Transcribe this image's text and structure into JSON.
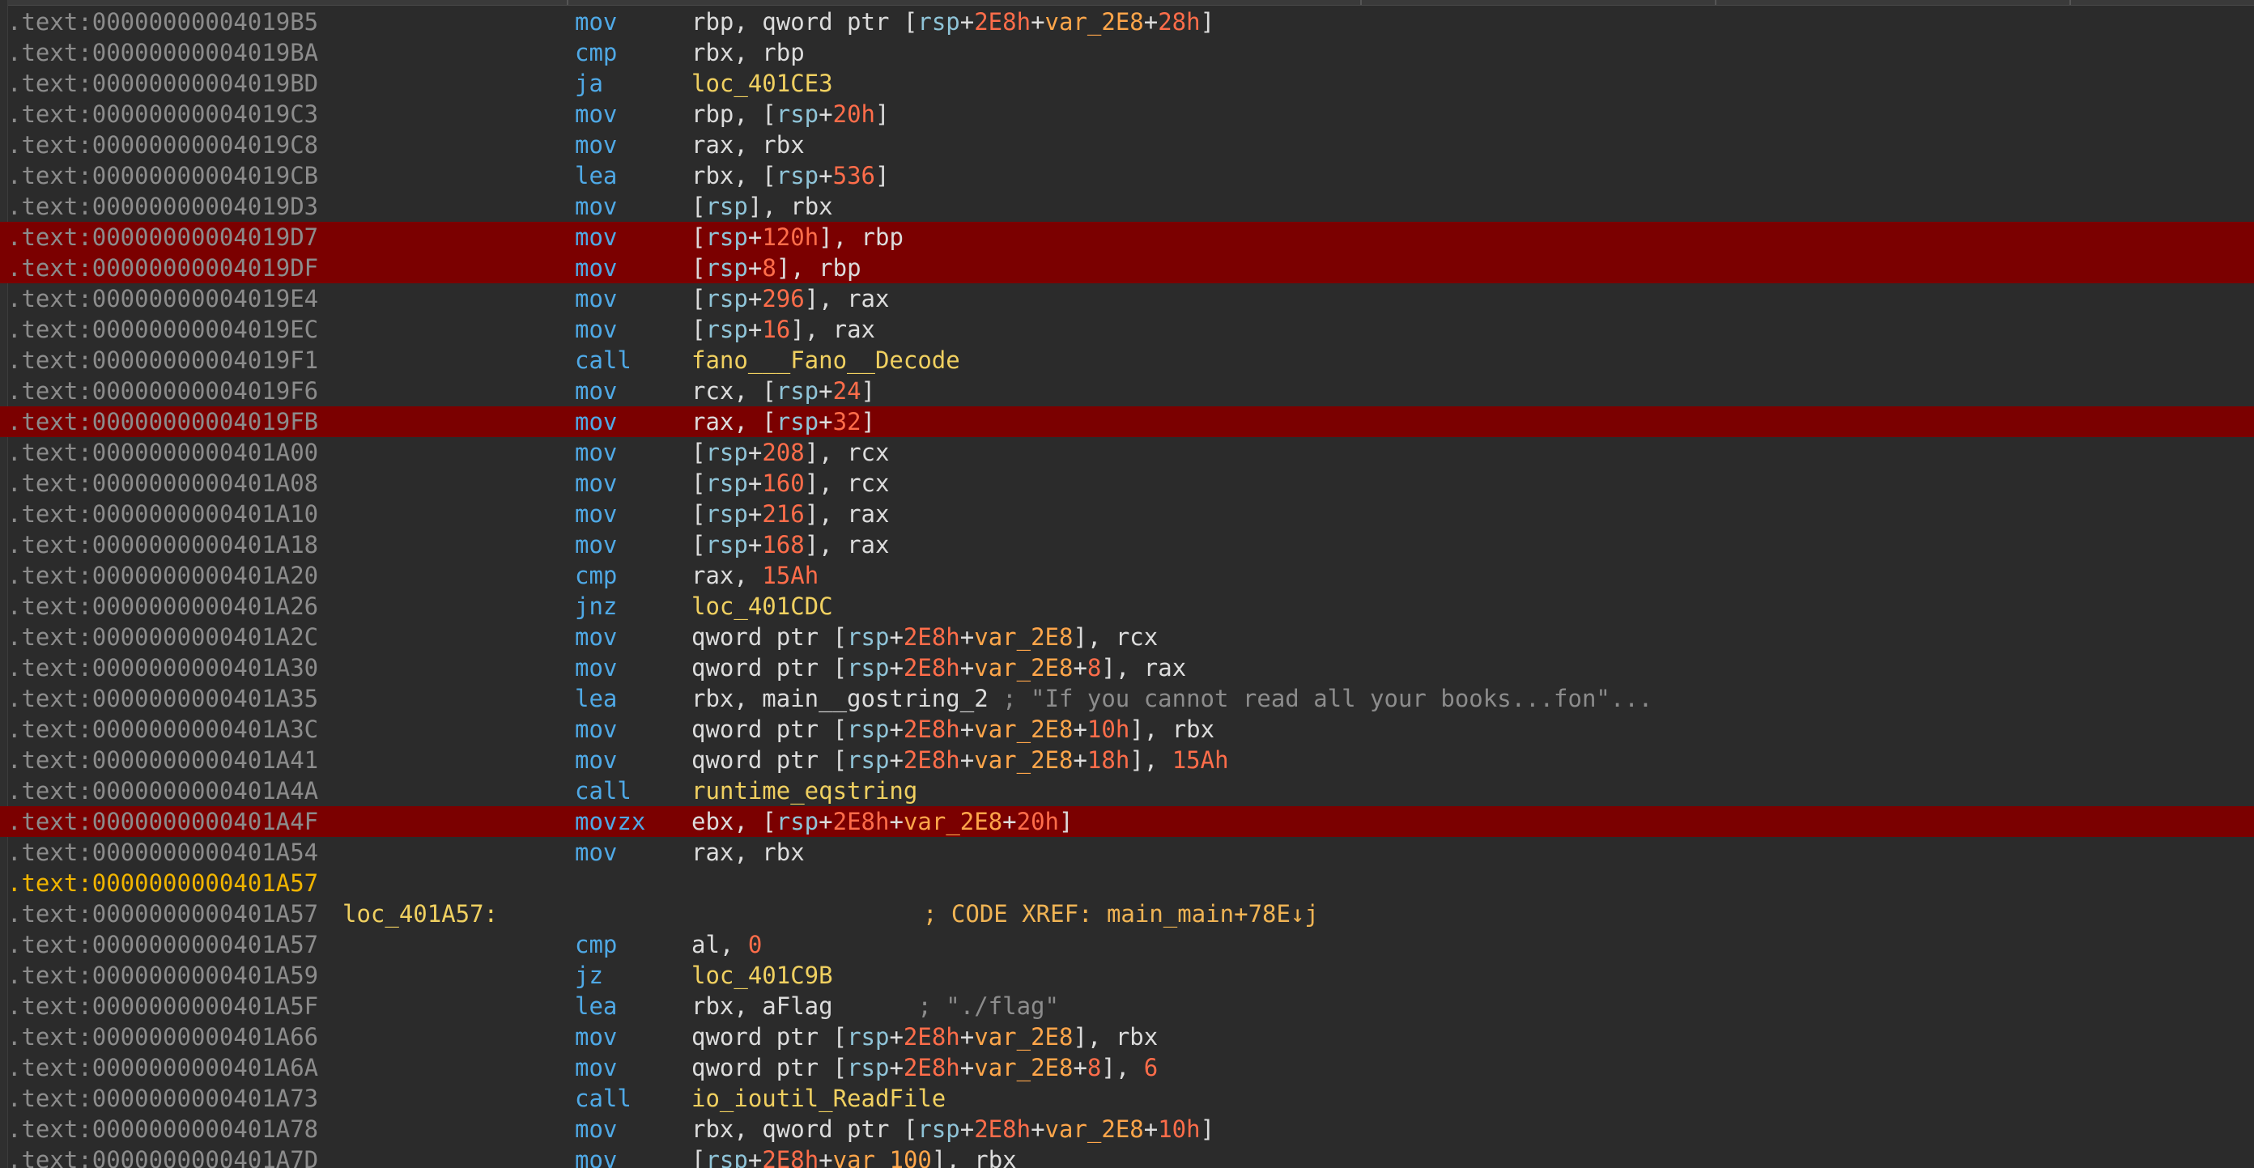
{
  "listing": {
    "rows": [
      {
        "addr": ".text:00000000004019B5",
        "mnem": "mov",
        "ops": [
          [
            "t",
            "rbp, qword ptr ["
          ],
          [
            "r",
            "rsp"
          ],
          [
            "t",
            "+"
          ],
          [
            "n",
            "2E8h"
          ],
          [
            "t",
            "+"
          ],
          [
            "v",
            "var_2E8"
          ],
          [
            "t",
            "+"
          ],
          [
            "n",
            "28h"
          ],
          [
            "t",
            "]"
          ]
        ]
      },
      {
        "addr": ".text:00000000004019BA",
        "mnem": "cmp",
        "ops": [
          [
            "t",
            "rbx, rbp"
          ]
        ]
      },
      {
        "addr": ".text:00000000004019BD",
        "mnem": "ja",
        "ops": [
          [
            "s",
            "loc_401CE3"
          ]
        ]
      },
      {
        "addr": ".text:00000000004019C3",
        "mnem": "mov",
        "ops": [
          [
            "t",
            "rbp, ["
          ],
          [
            "r",
            "rsp"
          ],
          [
            "t",
            "+"
          ],
          [
            "n",
            "20h"
          ],
          [
            "t",
            "]"
          ]
        ]
      },
      {
        "addr": ".text:00000000004019C8",
        "mnem": "mov",
        "ops": [
          [
            "t",
            "rax, rbx"
          ]
        ]
      },
      {
        "addr": ".text:00000000004019CB",
        "mnem": "lea",
        "ops": [
          [
            "t",
            "rbx, ["
          ],
          [
            "r",
            "rsp"
          ],
          [
            "t",
            "+"
          ],
          [
            "n",
            "536"
          ],
          [
            "t",
            "]"
          ]
        ]
      },
      {
        "addr": ".text:00000000004019D3",
        "mnem": "mov",
        "ops": [
          [
            "t",
            "["
          ],
          [
            "r",
            "rsp"
          ],
          [
            "t",
            "], rbx"
          ]
        ]
      },
      {
        "addr": ".text:00000000004019D7",
        "mnem": "mov",
        "hl": true,
        "ops": [
          [
            "t",
            "["
          ],
          [
            "r",
            "rsp"
          ],
          [
            "t",
            "+"
          ],
          [
            "n",
            "120h"
          ],
          [
            "t",
            "], rbp"
          ]
        ]
      },
      {
        "addr": ".text:00000000004019DF",
        "mnem": "mov",
        "hl": true,
        "ops": [
          [
            "t",
            "["
          ],
          [
            "r",
            "rsp"
          ],
          [
            "t",
            "+"
          ],
          [
            "n",
            "8"
          ],
          [
            "t",
            "], rbp"
          ]
        ]
      },
      {
        "addr": ".text:00000000004019E4",
        "mnem": "mov",
        "ops": [
          [
            "t",
            "["
          ],
          [
            "r",
            "rsp"
          ],
          [
            "t",
            "+"
          ],
          [
            "n",
            "296"
          ],
          [
            "t",
            "], rax"
          ]
        ]
      },
      {
        "addr": ".text:00000000004019EC",
        "mnem": "mov",
        "ops": [
          [
            "t",
            "["
          ],
          [
            "r",
            "rsp"
          ],
          [
            "t",
            "+"
          ],
          [
            "n",
            "16"
          ],
          [
            "t",
            "], rax"
          ]
        ]
      },
      {
        "addr": ".text:00000000004019F1",
        "mnem": "call",
        "ops": [
          [
            "s",
            "fano___Fano__Decode"
          ]
        ]
      },
      {
        "addr": ".text:00000000004019F6",
        "mnem": "mov",
        "ops": [
          [
            "t",
            "rcx, ["
          ],
          [
            "r",
            "rsp"
          ],
          [
            "t",
            "+"
          ],
          [
            "n",
            "24"
          ],
          [
            "t",
            "]"
          ]
        ]
      },
      {
        "addr": ".text:00000000004019FB",
        "mnem": "mov",
        "hl": true,
        "ops": [
          [
            "t",
            "rax, ["
          ],
          [
            "r",
            "rsp"
          ],
          [
            "t",
            "+"
          ],
          [
            "n",
            "32"
          ],
          [
            "t",
            "]"
          ]
        ]
      },
      {
        "addr": ".text:0000000000401A00",
        "mnem": "mov",
        "ops": [
          [
            "t",
            "["
          ],
          [
            "r",
            "rsp"
          ],
          [
            "t",
            "+"
          ],
          [
            "n",
            "208"
          ],
          [
            "t",
            "], rcx"
          ]
        ]
      },
      {
        "addr": ".text:0000000000401A08",
        "mnem": "mov",
        "ops": [
          [
            "t",
            "["
          ],
          [
            "r",
            "rsp"
          ],
          [
            "t",
            "+"
          ],
          [
            "n",
            "160"
          ],
          [
            "t",
            "], rcx"
          ]
        ]
      },
      {
        "addr": ".text:0000000000401A10",
        "mnem": "mov",
        "ops": [
          [
            "t",
            "["
          ],
          [
            "r",
            "rsp"
          ],
          [
            "t",
            "+"
          ],
          [
            "n",
            "216"
          ],
          [
            "t",
            "], rax"
          ]
        ]
      },
      {
        "addr": ".text:0000000000401A18",
        "mnem": "mov",
        "ops": [
          [
            "t",
            "["
          ],
          [
            "r",
            "rsp"
          ],
          [
            "t",
            "+"
          ],
          [
            "n",
            "168"
          ],
          [
            "t",
            "], rax"
          ]
        ]
      },
      {
        "addr": ".text:0000000000401A20",
        "mnem": "cmp",
        "ops": [
          [
            "t",
            "rax, "
          ],
          [
            "n",
            "15Ah"
          ]
        ]
      },
      {
        "addr": ".text:0000000000401A26",
        "mnem": "jnz",
        "ops": [
          [
            "s",
            "loc_401CDC"
          ]
        ]
      },
      {
        "addr": ".text:0000000000401A2C",
        "mnem": "mov",
        "ops": [
          [
            "t",
            "qword ptr ["
          ],
          [
            "r",
            "rsp"
          ],
          [
            "t",
            "+"
          ],
          [
            "n",
            "2E8h"
          ],
          [
            "t",
            "+"
          ],
          [
            "v",
            "var_2E8"
          ],
          [
            "t",
            "], rcx"
          ]
        ]
      },
      {
        "addr": ".text:0000000000401A30",
        "mnem": "mov",
        "ops": [
          [
            "t",
            "qword ptr ["
          ],
          [
            "r",
            "rsp"
          ],
          [
            "t",
            "+"
          ],
          [
            "n",
            "2E8h"
          ],
          [
            "t",
            "+"
          ],
          [
            "v",
            "var_2E8"
          ],
          [
            "t",
            "+"
          ],
          [
            "n",
            "8"
          ],
          [
            "t",
            "], rax"
          ]
        ]
      },
      {
        "addr": ".text:0000000000401A35",
        "mnem": "lea",
        "ops": [
          [
            "t",
            "rbx, main__gostring_2 "
          ],
          [
            "c",
            "; \"If you cannot read all your books...fon\"..."
          ]
        ]
      },
      {
        "addr": ".text:0000000000401A3C",
        "mnem": "mov",
        "ops": [
          [
            "t",
            "qword ptr ["
          ],
          [
            "r",
            "rsp"
          ],
          [
            "t",
            "+"
          ],
          [
            "n",
            "2E8h"
          ],
          [
            "t",
            "+"
          ],
          [
            "v",
            "var_2E8"
          ],
          [
            "t",
            "+"
          ],
          [
            "n",
            "10h"
          ],
          [
            "t",
            "], rbx"
          ]
        ]
      },
      {
        "addr": ".text:0000000000401A41",
        "mnem": "mov",
        "ops": [
          [
            "t",
            "qword ptr ["
          ],
          [
            "r",
            "rsp"
          ],
          [
            "t",
            "+"
          ],
          [
            "n",
            "2E8h"
          ],
          [
            "t",
            "+"
          ],
          [
            "v",
            "var_2E8"
          ],
          [
            "t",
            "+"
          ],
          [
            "n",
            "18h"
          ],
          [
            "t",
            "], "
          ],
          [
            "n",
            "15Ah"
          ]
        ]
      },
      {
        "addr": ".text:0000000000401A4A",
        "mnem": "call",
        "ops": [
          [
            "s",
            "runtime_eqstring"
          ]
        ]
      },
      {
        "addr": ".text:0000000000401A4F",
        "mnem": "movzx",
        "hl": true,
        "ops": [
          [
            "t",
            "ebx, ["
          ],
          [
            "r",
            "rsp"
          ],
          [
            "t",
            "+"
          ],
          [
            "n",
            "2E8h"
          ],
          [
            "t",
            "+"
          ],
          [
            "v",
            "var_2E8"
          ],
          [
            "t",
            "+"
          ],
          [
            "n",
            "20h"
          ],
          [
            "t",
            "]"
          ]
        ]
      },
      {
        "addr": ".text:0000000000401A54",
        "mnem": "mov",
        "ops": [
          [
            "t",
            "rax, rbx"
          ]
        ]
      },
      {
        "addr": ".text:0000000000401A57",
        "addr_gold": true,
        "mnem": "",
        "ops": []
      },
      {
        "addr": ".text:0000000000401A57",
        "label": "loc_401A57:",
        "mnem": "",
        "ops": [],
        "xref": "; CODE XREF: main_main+78E↓j"
      },
      {
        "addr": ".text:0000000000401A57",
        "mnem": "cmp",
        "ops": [
          [
            "t",
            "al, "
          ],
          [
            "n",
            "0"
          ]
        ]
      },
      {
        "addr": ".text:0000000000401A59",
        "mnem": "jz",
        "ops": [
          [
            "s",
            "loc_401C9B"
          ]
        ]
      },
      {
        "addr": ".text:0000000000401A5F",
        "mnem": "lea",
        "ops": [
          [
            "t",
            "rbx, aFlag      "
          ],
          [
            "c",
            "; \"./flag\""
          ]
        ]
      },
      {
        "addr": ".text:0000000000401A66",
        "mnem": "mov",
        "ops": [
          [
            "t",
            "qword ptr ["
          ],
          [
            "r",
            "rsp"
          ],
          [
            "t",
            "+"
          ],
          [
            "n",
            "2E8h"
          ],
          [
            "t",
            "+"
          ],
          [
            "v",
            "var_2E8"
          ],
          [
            "t",
            "], rbx"
          ]
        ]
      },
      {
        "addr": ".text:0000000000401A6A",
        "mnem": "mov",
        "ops": [
          [
            "t",
            "qword ptr ["
          ],
          [
            "r",
            "rsp"
          ],
          [
            "t",
            "+"
          ],
          [
            "n",
            "2E8h"
          ],
          [
            "t",
            "+"
          ],
          [
            "v",
            "var_2E8"
          ],
          [
            "t",
            "+"
          ],
          [
            "n",
            "8"
          ],
          [
            "t",
            "], "
          ],
          [
            "n",
            "6"
          ]
        ]
      },
      {
        "addr": ".text:0000000000401A73",
        "mnem": "call",
        "ops": [
          [
            "s",
            "io_ioutil_ReadFile"
          ]
        ]
      },
      {
        "addr": ".text:0000000000401A78",
        "mnem": "mov",
        "ops": [
          [
            "t",
            "rbx, qword ptr ["
          ],
          [
            "r",
            "rsp"
          ],
          [
            "t",
            "+"
          ],
          [
            "n",
            "2E8h"
          ],
          [
            "t",
            "+"
          ],
          [
            "v",
            "var_2E8"
          ],
          [
            "t",
            "+"
          ],
          [
            "n",
            "10h"
          ],
          [
            "t",
            "]"
          ]
        ]
      },
      {
        "addr": ".text:0000000000401A7D",
        "mnem": "mov",
        "ops": [
          [
            "t",
            "["
          ],
          [
            "r",
            "rsp"
          ],
          [
            "t",
            "+"
          ],
          [
            "n",
            "2E8h"
          ],
          [
            "t",
            "+"
          ],
          [
            "v",
            "var_100"
          ],
          [
            "t",
            "], rbx"
          ]
        ]
      }
    ]
  },
  "colors": {
    "background": "#2b2b2b",
    "highlight": "#7b0000",
    "address": "#8c8c8c",
    "mnemonic": "#4fa9e6",
    "number": "#ff6d4a",
    "variable": "#ffa64a",
    "symbol": "#f0d060"
  }
}
